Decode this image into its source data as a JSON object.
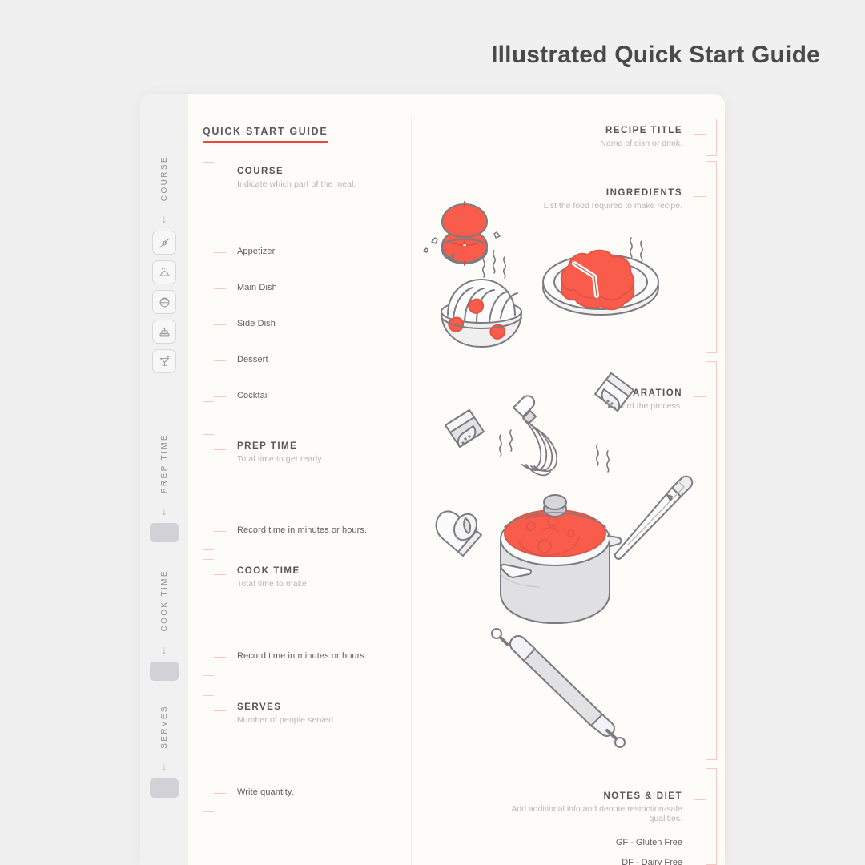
{
  "header": {
    "title": "Illustrated Quick Start Guide"
  },
  "page": {
    "guide_label": "QUICK START GUIDE",
    "accent_color": "#f0463c",
    "bracket_color": "#f8c9c4",
    "paper_color": "#fdfcf8",
    "sidebar_color": "#f1f1f1",
    "canvas_color": "#f0f0f0"
  },
  "sidebar": {
    "groups": [
      {
        "label": "COURSE",
        "arrow": "↓",
        "icons": [
          {
            "name": "skewer-icon",
            "for": "Appetizer"
          },
          {
            "name": "cloche-icon",
            "for": "Main Dish"
          },
          {
            "name": "rice-bowl-icon",
            "for": "Side Dish"
          },
          {
            "name": "cake-icon",
            "for": "Dessert"
          },
          {
            "name": "cocktail-glass-icon",
            "for": "Cocktail"
          }
        ]
      },
      {
        "label": "PREP TIME",
        "arrow": "↓",
        "field": "input-box"
      },
      {
        "label": "COOK TIME",
        "arrow": "↓",
        "field": "input-box"
      },
      {
        "label": "SERVES",
        "arrow": "↓",
        "field": "input-box"
      }
    ]
  },
  "left_column": {
    "sections": [
      {
        "title": "COURSE",
        "subtitle": "Indicate which part of the meal.",
        "items": [
          "Appetizer",
          "Main Dish",
          "Side Dish",
          "Dessert",
          "Cocktail"
        ]
      },
      {
        "title": "PREP TIME",
        "subtitle": "Total time to get ready.",
        "items": [
          "Record time in minutes or hours."
        ]
      },
      {
        "title": "COOK TIME",
        "subtitle": "Total time to make.",
        "items": [
          "Record time in minutes or hours."
        ]
      },
      {
        "title": "SERVES",
        "subtitle": "Number of people served.",
        "items": [
          "Write quantity."
        ]
      }
    ]
  },
  "right_column": {
    "sections": [
      {
        "title": "RECIPE TITLE",
        "subtitle": "Name of dish or drink.",
        "notes": []
      },
      {
        "title": "INGREDIENTS",
        "subtitle": "List the food required to make recipe.",
        "notes": []
      },
      {
        "title": "PREPARATION",
        "subtitle": "Record the process.",
        "notes": []
      },
      {
        "title": "NOTES & DIET",
        "subtitle": "Add additional info and denote restriction-safe qualities.",
        "notes": [
          "GF - Gluten Free",
          "DF - Dairy Free"
        ]
      }
    ]
  },
  "illustrations": {
    "ingredients": [
      "sliced-tomato-icon",
      "noodle-bowl-icon",
      "steak-plate-icon"
    ],
    "preparation": [
      "whisk-icon",
      "pepper-shaker-icon",
      "salt-shaker-icon",
      "measuring-cup-icon",
      "cooking-pot-icon",
      "chef-knife-icon",
      "rolling-pin-icon"
    ]
  }
}
